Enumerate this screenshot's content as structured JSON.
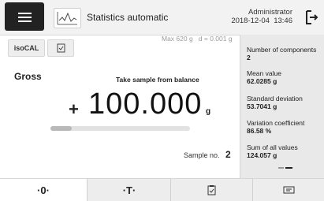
{
  "header": {
    "app_title": "Statistics automatic",
    "user": "Administrator",
    "date": "2018-12-04",
    "time": "13:46",
    "menu_icon": "hamburger-icon",
    "app_icon": "statistics-chart-icon",
    "logout_icon": "logout-icon"
  },
  "toolbar": {
    "isocal_label": "isoCAL",
    "doc_icon": "document-icon"
  },
  "scale": {
    "max": "Max 620 g",
    "d": "d = 0.001 g",
    "mode": "Gross",
    "prompt": "Take sample from balance",
    "sign": "+",
    "value": "100.000",
    "unit": "g",
    "capacity_fraction": 0.15
  },
  "sample": {
    "label": "Sample no.",
    "value": "2"
  },
  "stats": [
    {
      "label": "Number of components",
      "value": "2"
    },
    {
      "label": "Mean value",
      "value": "62.0285 g"
    },
    {
      "label": "Standard deviation",
      "value": "53.7041 g"
    },
    {
      "label": "Variation coefficient",
      "value": "86.58 %"
    },
    {
      "label": "Sum of all values",
      "value": "124.057 g"
    }
  ],
  "bottom": {
    "zero_label": "·0·",
    "tare_label": "·T·",
    "copy_icon": "clipboard-check-icon",
    "print_icon": "printer-icon"
  }
}
